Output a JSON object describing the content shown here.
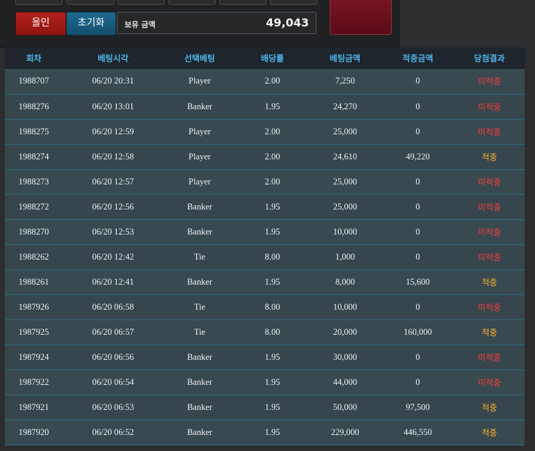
{
  "controls": {
    "allin_label": "올인",
    "reset_label": "초기화",
    "balance_label": "보유 금액",
    "balance_value": "49,043"
  },
  "colors": {
    "header_text": "#4fb3e8",
    "lose": "#ff3b3b",
    "win": "#ffb42b",
    "allin_button": "#b3201b",
    "reset_button": "#1d6a8f"
  },
  "table": {
    "headers": [
      "회차",
      "베팅시각",
      "선택베팅",
      "배당률",
      "베팅금액",
      "적중금액",
      "당첨결과"
    ],
    "rows": [
      {
        "round": "1988707",
        "time": "06/20 20:31",
        "pick": "Player",
        "odds": "2.00",
        "bet": "7,250",
        "win": "0",
        "result": "미적중",
        "status": "lose"
      },
      {
        "round": "1988276",
        "time": "06/20 13:01",
        "pick": "Banker",
        "odds": "1.95",
        "bet": "24,270",
        "win": "0",
        "result": "미적중",
        "status": "lose"
      },
      {
        "round": "1988275",
        "time": "06/20 12:59",
        "pick": "Player",
        "odds": "2.00",
        "bet": "25,000",
        "win": "0",
        "result": "미적중",
        "status": "lose"
      },
      {
        "round": "1988274",
        "time": "06/20 12:58",
        "pick": "Player",
        "odds": "2.00",
        "bet": "24,610",
        "win": "49,220",
        "result": "적중",
        "status": "win"
      },
      {
        "round": "1988273",
        "time": "06/20 12:57",
        "pick": "Player",
        "odds": "2.00",
        "bet": "25,000",
        "win": "0",
        "result": "미적중",
        "status": "lose"
      },
      {
        "round": "1988272",
        "time": "06/20 12:56",
        "pick": "Banker",
        "odds": "1.95",
        "bet": "25,000",
        "win": "0",
        "result": "미적중",
        "status": "lose"
      },
      {
        "round": "1988270",
        "time": "06/20 12:53",
        "pick": "Banker",
        "odds": "1.95",
        "bet": "10,000",
        "win": "0",
        "result": "미적중",
        "status": "lose"
      },
      {
        "round": "1988262",
        "time": "06/20 12:42",
        "pick": "Tie",
        "odds": "8.00",
        "bet": "1,000",
        "win": "0",
        "result": "미적중",
        "status": "lose"
      },
      {
        "round": "1988261",
        "time": "06/20 12:41",
        "pick": "Banker",
        "odds": "1.95",
        "bet": "8,000",
        "win": "15,600",
        "result": "적중",
        "status": "win"
      },
      {
        "round": "1987926",
        "time": "06/20 06:58",
        "pick": "Tie",
        "odds": "8.00",
        "bet": "10,000",
        "win": "0",
        "result": "미적중",
        "status": "lose"
      },
      {
        "round": "1987925",
        "time": "06/20 06:57",
        "pick": "Tie",
        "odds": "8.00",
        "bet": "20,000",
        "win": "160,000",
        "result": "적중",
        "status": "win"
      },
      {
        "round": "1987924",
        "time": "06/20 06:56",
        "pick": "Banker",
        "odds": "1.95",
        "bet": "30,000",
        "win": "0",
        "result": "미적중",
        "status": "lose"
      },
      {
        "round": "1987922",
        "time": "06/20 06:54",
        "pick": "Banker",
        "odds": "1.95",
        "bet": "44,000",
        "win": "0",
        "result": "미적중",
        "status": "lose"
      },
      {
        "round": "1987921",
        "time": "06/20 06:53",
        "pick": "Banker",
        "odds": "1.95",
        "bet": "50,000",
        "win": "97,500",
        "result": "적중",
        "status": "win"
      },
      {
        "round": "1987920",
        "time": "06/20 06:52",
        "pick": "Banker",
        "odds": "1.95",
        "bet": "229,000",
        "win": "446,550",
        "result": "적중",
        "status": "win"
      }
    ]
  }
}
